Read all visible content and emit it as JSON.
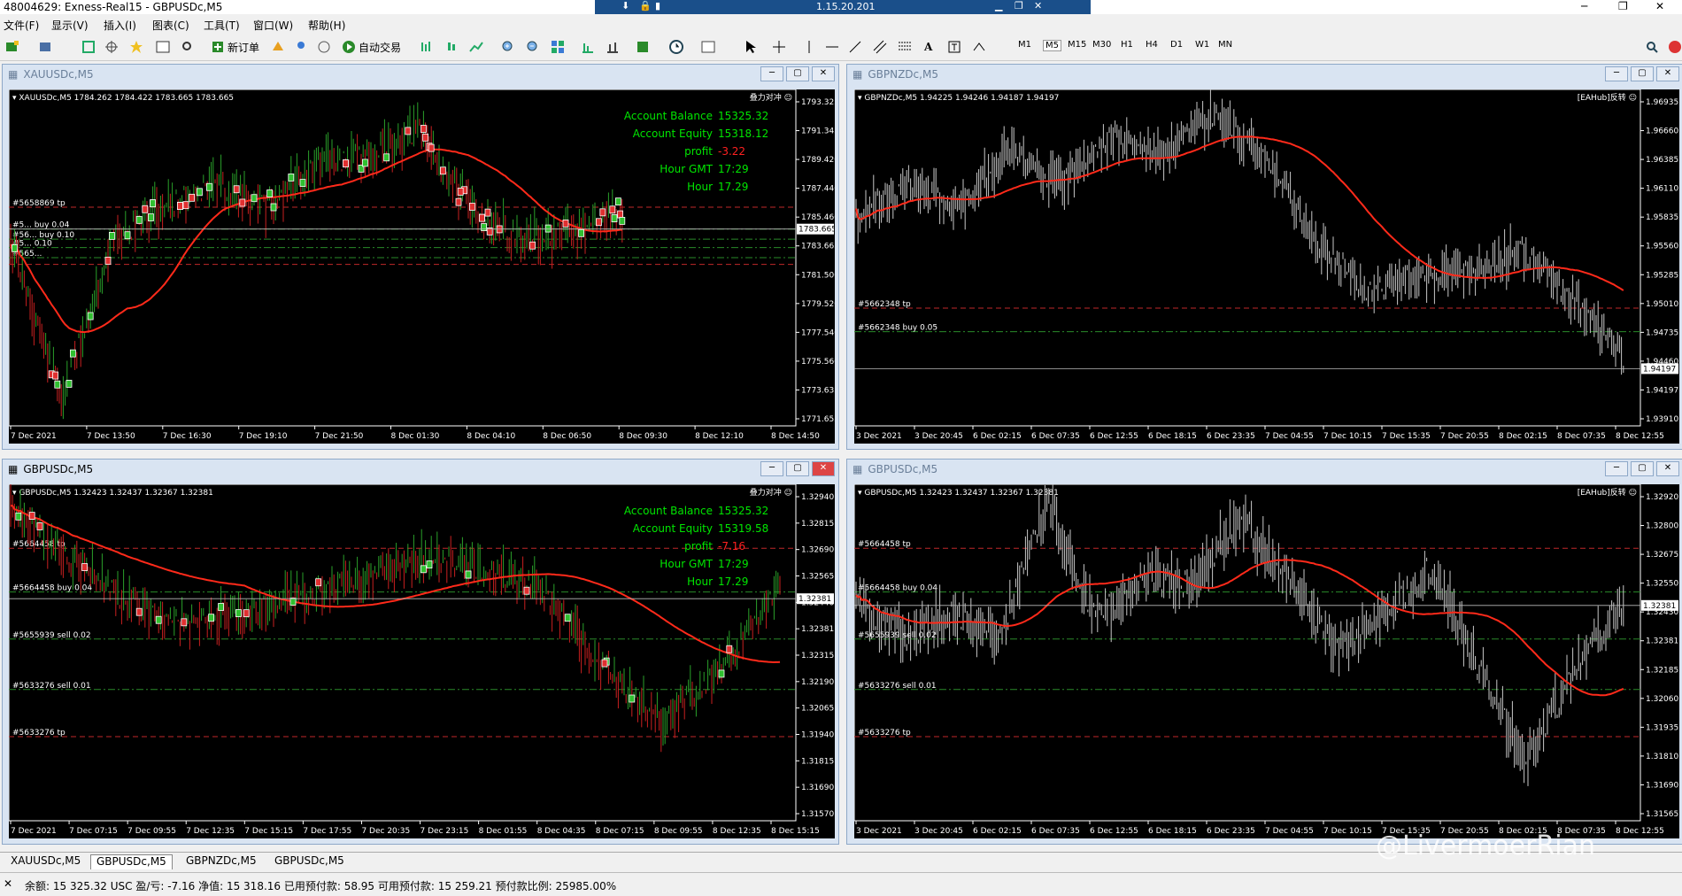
{
  "window": {
    "title": "48004629: Exness-Real15 - GBPUSDc,M5",
    "server": "1.15.20.201"
  },
  "menu": [
    "文件(F)",
    "显示(V)",
    "插入(I)",
    "图表(C)",
    "工具(T)",
    "窗口(W)",
    "帮助(H)"
  ],
  "toolbar": {
    "new_order": "新订单",
    "auto_trade": "自动交易",
    "timeframes": [
      "M1",
      "M5",
      "M15",
      "M30",
      "H1",
      "H4",
      "D1",
      "W1",
      "MN"
    ]
  },
  "charts": {
    "c1": {
      "window_title": "XAUUSDc,M5",
      "header": "XAUUSDc,M5  1784.262 1784.422 1783.665 1783.665",
      "corner": "叠力对冲 ☺",
      "info": [
        {
          "label": "Account Balance",
          "value": "15325.32"
        },
        {
          "label": "Account Equity",
          "value": "15318.12"
        },
        {
          "label": "profit",
          "value": "-3.22"
        },
        {
          "label": "Hour GMT",
          "value": "17:29"
        },
        {
          "label": "Hour",
          "value": "17.29"
        }
      ],
      "prices": [
        "1793.325",
        "1791.345",
        "1789.420",
        "1787.440",
        "1785.460",
        "1783.665",
        "1781.500",
        "1779.520",
        "1777.540",
        "1775.560",
        "1773.635",
        "1771.655"
      ],
      "price_tag": "1783.665",
      "times": [
        "7 Dec 2021",
        "7 Dec 13:50",
        "7 Dec 16:30",
        "7 Dec 19:10",
        "7 Dec 21:50",
        "8 Dec 01:30",
        "8 Dec 04:10",
        "8 Dec 06:50",
        "8 Dec 09:30",
        "8 Dec 12:10",
        "8 Dec 14:50"
      ],
      "order_labels": [
        "#5658869 tp",
        "#5... buy 0.04",
        "#56... buy 0.10",
        "#5... 0.10",
        "#565... "
      ]
    },
    "c2": {
      "window_title": "GBPNZDc,M5",
      "header": "GBPNZDc,M5  1.94225 1.94246 1.94187 1.94197",
      "corner": "[EAHub]反转 ☺",
      "prices": [
        "1.96935",
        "1.96660",
        "1.96385",
        "1.96110",
        "1.95835",
        "1.95560",
        "1.95285",
        "1.95010",
        "1.94735",
        "1.94460",
        "1.94197",
        "1.93910"
      ],
      "price_tag": "1.94197",
      "times": [
        "3 Dec 2021",
        "3 Dec 20:45",
        "6 Dec 02:15",
        "6 Dec 07:35",
        "6 Dec 12:55",
        "6 Dec 18:15",
        "6 Dec 23:35",
        "7 Dec 04:55",
        "7 Dec 10:15",
        "7 Dec 15:35",
        "7 Dec 20:55",
        "8 Dec 02:15",
        "8 Dec 07:35",
        "8 Dec 12:55"
      ],
      "order_labels": [
        "#5662348 tp",
        "#5662348 buy 0.05"
      ]
    },
    "c3": {
      "window_title": "GBPUSDc,M5",
      "header": "GBPUSDc,M5  1.32423 1.32437 1.32367 1.32381",
      "corner": "叠力对冲 ☺",
      "info": [
        {
          "label": "Account Balance",
          "value": "15325.32"
        },
        {
          "label": "Account Equity",
          "value": "15319.58"
        },
        {
          "label": "profit",
          "value": "-7.16"
        },
        {
          "label": "Hour GMT",
          "value": "17:29"
        },
        {
          "label": "Hour",
          "value": "17.29"
        }
      ],
      "prices": [
        "1.32940",
        "1.32815",
        "1.32690",
        "1.32565",
        "1.32440",
        "1.32381",
        "1.32315",
        "1.32190",
        "1.32065",
        "1.31940",
        "1.31815",
        "1.31690",
        "1.31570"
      ],
      "price_tag": "1.32381",
      "times": [
        "7 Dec 2021",
        "7 Dec 07:15",
        "7 Dec 09:55",
        "7 Dec 12:35",
        "7 Dec 15:15",
        "7 Dec 17:55",
        "7 Dec 20:35",
        "7 Dec 23:15",
        "8 Dec 01:55",
        "8 Dec 04:35",
        "8 Dec 07:15",
        "8 Dec 09:55",
        "8 Dec 12:35",
        "8 Dec 15:15"
      ],
      "order_labels": [
        "#5664458 tp",
        "#5664458 buy 0.04",
        "#5655939 sell 0.02",
        "#5633276 sell 0.01",
        "#5633276 tp"
      ]
    },
    "c4": {
      "window_title": "GBPUSDc,M5",
      "header": "GBPUSDc,M5  1.32423 1.32437 1.32367 1.32381",
      "corner": "[EAHub]反转 ☺",
      "prices": [
        "1.32920",
        "1.32800",
        "1.32675",
        "1.32550",
        "1.32430",
        "1.32381",
        "1.32185",
        "1.32060",
        "1.31935",
        "1.31810",
        "1.31690",
        "1.31565"
      ],
      "price_tag": "1.32381",
      "times": [
        "3 Dec 2021",
        "3 Dec 20:45",
        "6 Dec 02:15",
        "6 Dec 07:35",
        "6 Dec 12:55",
        "6 Dec 18:15",
        "6 Dec 23:35",
        "7 Dec 04:55",
        "7 Dec 10:15",
        "7 Dec 15:35",
        "7 Dec 20:55",
        "8 Dec 02:15",
        "8 Dec 07:35",
        "8 Dec 12:55"
      ],
      "order_labels": [
        "#5664458 tp",
        "#5664458 buy 0.04",
        "#5655939 sell 0.02",
        "#5633276 sell 0.01",
        "#5633276 tp"
      ]
    }
  },
  "tabs": [
    "XAUUSDc,M5",
    "GBPUSDc,M5",
    "GBPNZDc,M5",
    "GBPUSDc,M5"
  ],
  "active_tab": 1,
  "status": "余额: 15 325.32 USC  盈/亏: -7.16  净值: 15 318.16  已用预付款: 58.95  可用预付款: 15 259.21  预付款比例: 25985.00%",
  "watermark": "@LivermoerRian",
  "colors": {
    "ma": "#ff2a1a",
    "tp_line": "#c0282a",
    "order_line": "#2a8a2a",
    "info": "#00e600",
    "profit": "#ff2020",
    "bars": "#c8c8c8"
  }
}
